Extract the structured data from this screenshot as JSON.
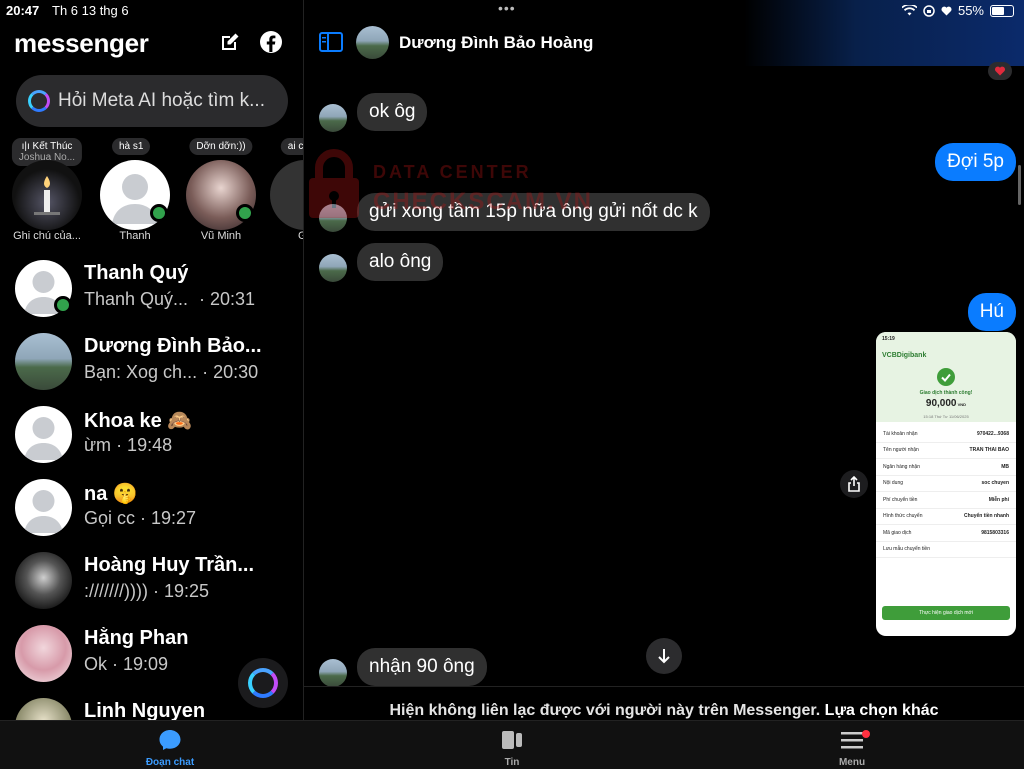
{
  "status_bar": {
    "time": "20:47",
    "date": "Th 6 13 thg 6",
    "battery": "55%"
  },
  "sidebar": {
    "brand": "messenger",
    "search_placeholder": "Hỏi Meta AI hoặc tìm k...",
    "stories": [
      {
        "note_line1": "Kết Thúc",
        "note_line2": "Joshua No...",
        "label": "Ghi chú của..."
      },
      {
        "note_line1": "hà s1",
        "label": "Thanh"
      },
      {
        "note_line1": "Dỡn dỡn:))",
        "label": "Vũ Minh"
      },
      {
        "note_line1": "ai có xe",
        "label": "G"
      }
    ],
    "conversations": [
      {
        "name": "Thanh Quý",
        "preview": "Thanh Quý...",
        "time": "· 20:31",
        "online": true
      },
      {
        "name": "Dương Đình Bảo...",
        "preview": "Bạn: Xog ch...",
        "time": "· 20:30",
        "online": false
      },
      {
        "name": "Khoa ke 🙈",
        "preview": "ừm",
        "time": "· 19:48",
        "online": false
      },
      {
        "name": "na 🤫",
        "preview": "Gọi cc",
        "time": "· 19:27",
        "online": false
      },
      {
        "name": "Hoàng Huy Trần...",
        "preview": ":///////))))",
        "time": "· 19:25",
        "online": false
      },
      {
        "name": "Hằng Phan",
        "preview": "Ok",
        "time": "· 19:09",
        "online": false
      },
      {
        "name": "Linh Nguyen",
        "preview": "",
        "time": "",
        "online": false
      }
    ]
  },
  "chat": {
    "title": "Dương Đình Bảo Hoàng",
    "messages": [
      {
        "dir": "in",
        "text": "ok ôg"
      },
      {
        "dir": "out",
        "text": "Đợi 5p"
      },
      {
        "dir": "in",
        "text": "gửi xong tầm 15p nữa ông gửi nốt dc k"
      },
      {
        "dir": "in",
        "text": "alo ông"
      },
      {
        "dir": "out",
        "text": "Hú"
      },
      {
        "dir": "in",
        "text": "nhận 90 ông"
      }
    ],
    "footer_text": "Hiện không liên lạc được với người này trên Messenger.",
    "footer_link": "Lựa chọn khác",
    "receipt": {
      "time": "15:19",
      "bank": "VCBDigibank",
      "status": "Giao dịch thành công!",
      "amount": "90,000",
      "currency": "VND",
      "datetime": "15:18 Thứ Tư 11/06/2025",
      "rows": [
        {
          "label": "Tài khoản nhận",
          "value": "970422...9368"
        },
        {
          "label": "Tên người nhận",
          "value": "TRAN THAI BAO"
        },
        {
          "label": "Ngân hàng nhận",
          "value": "MB"
        },
        {
          "label": "Nội dung",
          "value": "soc chuyen"
        },
        {
          "label": "Phí chuyển tiền",
          "value": "Miễn phí"
        },
        {
          "label": "Hình thức chuyển",
          "value": "Chuyển tiền nhanh"
        },
        {
          "label": "Mã giao dịch",
          "value": "9815803316"
        },
        {
          "label": "Lưu mẫu chuyển tiền",
          "value": ""
        }
      ],
      "button": "Thực hiện giao dịch mới"
    }
  },
  "watermark": {
    "line1": "DATA CENTER",
    "line2": "CHECKSCAM.VN"
  },
  "tabbar": [
    {
      "label": "Đoạn chat",
      "active": true
    },
    {
      "label": "Tin",
      "active": false
    },
    {
      "label": "Menu",
      "active": false
    }
  ],
  "colors": {
    "accent": "#0a7cff",
    "online": "#31a24c",
    "tab_active": "#3b9cff"
  }
}
